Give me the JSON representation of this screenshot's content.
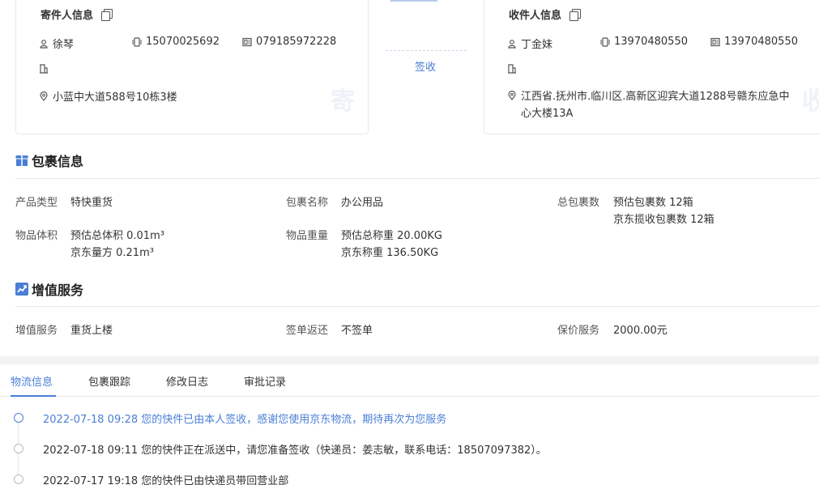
{
  "sender": {
    "title": "寄件人信息",
    "name": "徐琴",
    "mobile": "15070025692",
    "phone": "079185972228",
    "address": "小蓝中大道588号10栋3楼",
    "watermark": "寄"
  },
  "receiver": {
    "title": "收件人信息",
    "name": "丁金妹",
    "mobile": "13970480550",
    "phone": "13970480550",
    "address_line1": "江西省.抚州市.临川区.高新区迎宾大道1288号赣东应急中",
    "address_line2": "心大楼13A",
    "watermark": "收"
  },
  "status_label": "签收",
  "package": {
    "section_title": "包裹信息",
    "product_type_label": "产品类型",
    "product_type": "特快重货",
    "package_name_label": "包裹名称",
    "package_name": "办公用品",
    "total_label": "总包裹数",
    "total_line1": "预估包裹数 12箱",
    "total_line2": "京东揽收包裹数 12箱",
    "volume_label": "物品体积",
    "volume_line1": "预估总体积 0.01m³",
    "volume_line2": "京东量方 0.21m³",
    "weight_label": "物品重量",
    "weight_line1": "预估总称重 20.00KG",
    "weight_line2": "京东称重 136.50KG"
  },
  "value_added": {
    "section_title": "增值服务",
    "service_label": "增值服务",
    "service": "重货上楼",
    "receipt_label": "签单返还",
    "receipt": "不签单",
    "insurance_label": "保价服务",
    "insurance": "2000.00元"
  },
  "tabs": [
    {
      "label": "物流信息",
      "active": true
    },
    {
      "label": "包裹跟踪",
      "active": false
    },
    {
      "label": "修改日志",
      "active": false
    },
    {
      "label": "审批记录",
      "active": false
    }
  ],
  "timeline": [
    {
      "text": "2022-07-18 09:28 您的快件已由本人签收，感谢您使用京东物流，期待再次为您服务",
      "active": true
    },
    {
      "text": "2022-07-18 09:11 您的快件正在派送中，请您准备签收（快递员：姜志敏，联系电话：18507097382）。",
      "active": false
    },
    {
      "text": "2022-07-17 19:18 您的快件已由快递员带回营业部",
      "active": false
    }
  ],
  "colors": {
    "accent": "#4a7fd6",
    "divider": "#e8e8e8",
    "band": "#f2f2f2"
  }
}
